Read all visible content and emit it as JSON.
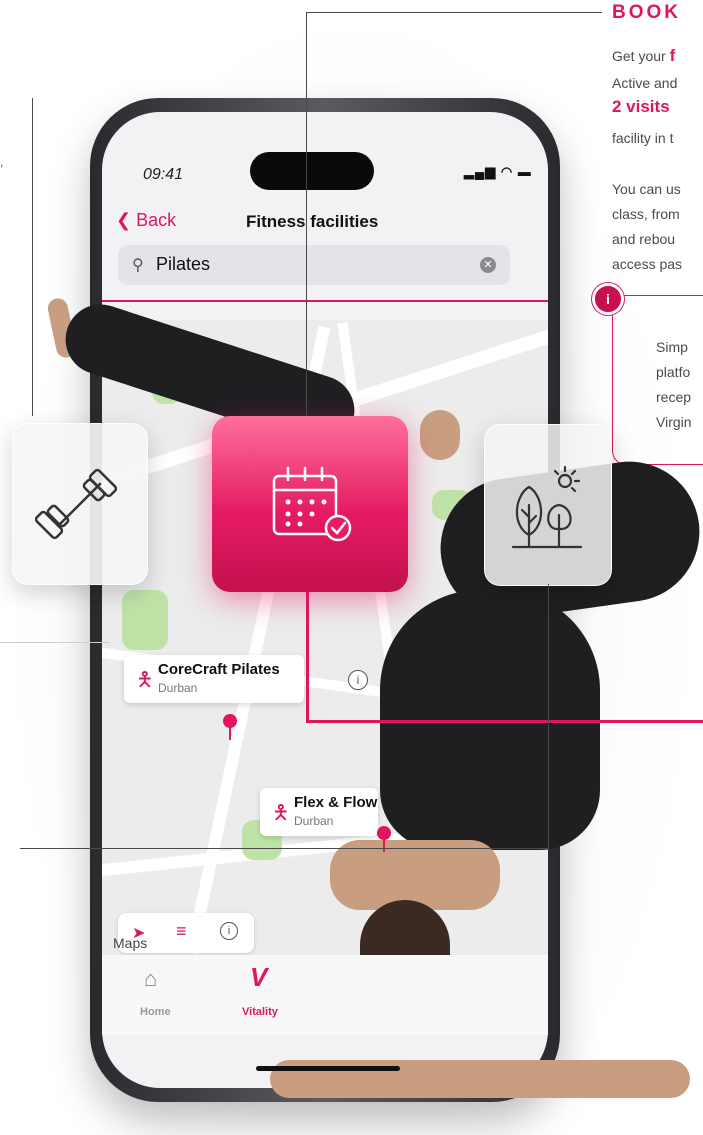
{
  "panel": {
    "heading": "BOOK",
    "line1_prefix": "Get your ",
    "line1_bold": "f",
    "line2": "Active and",
    "line3_bold": "2 visits",
    "line4": "facility in t",
    "line5": "You can us",
    "line6": "class, from",
    "line7": "and rebou",
    "line8": "access pas",
    "info_icon": "i",
    "info_lines": [
      "Simp",
      "platfo",
      "recep",
      "Virgin"
    ]
  },
  "phone": {
    "time": "09:41",
    "status_icons": "signal-wifi-battery",
    "back_label": "Back",
    "title": "Fitness facilities",
    "search_value": "Pilates",
    "cards": [
      {
        "title": "CoreCraft Pilates",
        "location": "Durban"
      },
      {
        "title": "Flex & Flow",
        "location": "Durban"
      }
    ],
    "maps_label": "Maps",
    "tabs": [
      {
        "label": "Home"
      },
      {
        "label": "Vitality"
      }
    ]
  },
  "colors": {
    "accent": "#e0155f"
  },
  "tiles": [
    "dumbbell-icon",
    "calendar-check-icon",
    "tree-sun-icon"
  ]
}
